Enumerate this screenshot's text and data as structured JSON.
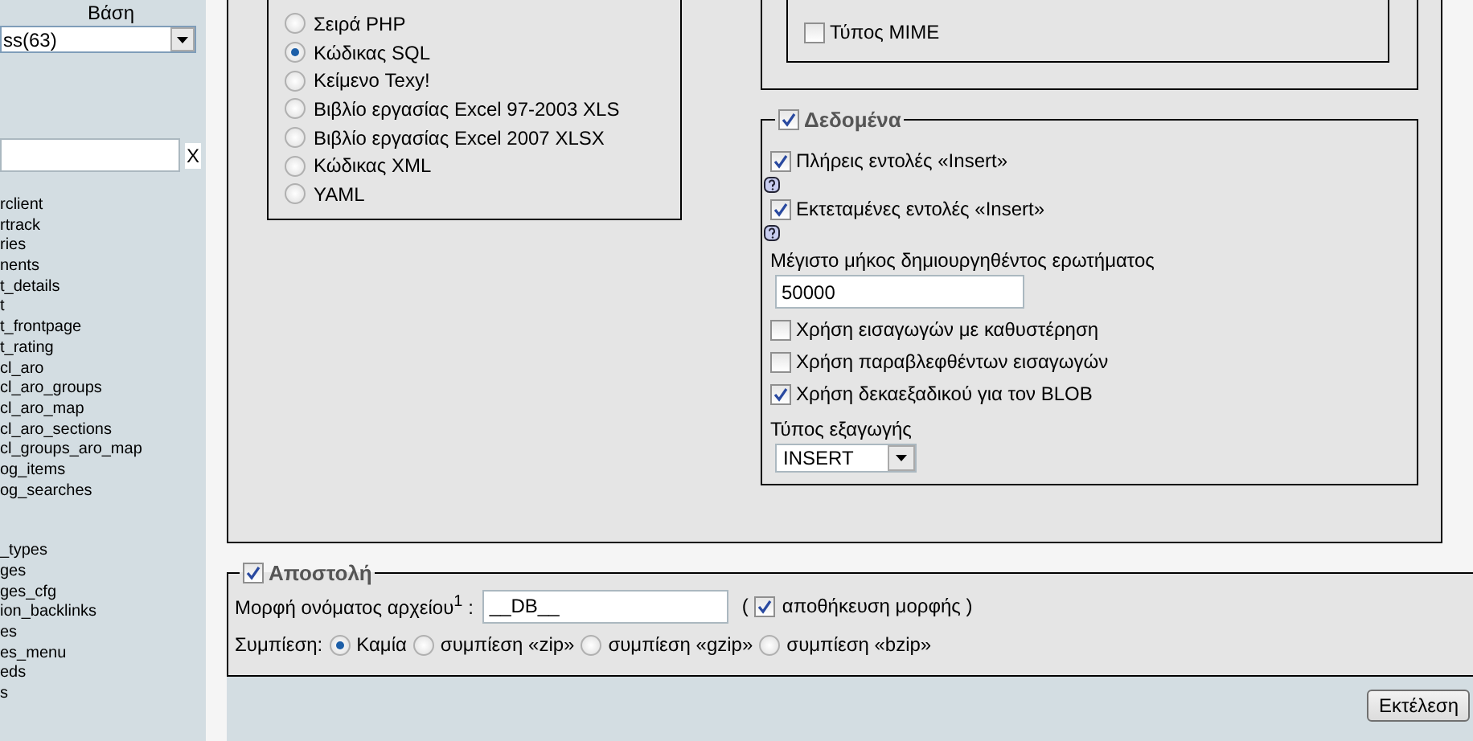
{
  "sidebar": {
    "database_label": "Βάση",
    "database_select": "ss(63)",
    "filter_clear": "X",
    "table_groups": [
      {
        "items": [
          "rclient",
          "rtrack",
          "ries",
          "nents",
          "t_details",
          "t",
          "t_frontpage",
          "t_rating",
          "cl_aro",
          "cl_aro_groups",
          "cl_aro_map",
          "cl_aro_sections",
          "cl_groups_aro_map",
          "og_items",
          "og_searches"
        ]
      },
      {
        "items": [
          "_types",
          "ges",
          "ges_cfg",
          "ion_backlinks",
          "es",
          "es_menu",
          "eds",
          "s"
        ]
      }
    ]
  },
  "export_formats": [
    {
      "label": "Σειρά PHP",
      "selected": false
    },
    {
      "label": "Κώδικας SQL",
      "selected": true
    },
    {
      "label": "Κείμενο Texy!",
      "selected": false
    },
    {
      "label": "Βιβλίο εργασίας Excel 97-2003 XLS",
      "selected": false
    },
    {
      "label": "Βιβλίο εργασίας Excel 2007 XLSX",
      "selected": false
    },
    {
      "label": "Κώδικας XML",
      "selected": false
    },
    {
      "label": "YAML",
      "selected": false
    }
  ],
  "structure_options": [
    {
      "label": "Τύπος MIME",
      "checked": false
    }
  ],
  "data_section": {
    "legend": "Δεδομένα",
    "checked": true,
    "items": [
      {
        "kind": "checkbox",
        "label": "Πλήρεις εντολές «Insert»",
        "checked": true
      },
      {
        "kind": "help"
      },
      {
        "kind": "checkbox",
        "label": "Εκτεταμένες εντολές «Insert»",
        "checked": true
      },
      {
        "kind": "help"
      },
      {
        "kind": "field",
        "label": "Μέγιστο μήκος δημιουργηθέντος ερωτήματος",
        "value": "50000"
      },
      {
        "kind": "checkbox",
        "label": "Χρήση εισαγωγών με καθυστέρηση",
        "checked": false
      },
      {
        "kind": "checkbox",
        "label": "Χρήση παραβλεφθέντων εισαγωγών",
        "checked": false
      },
      {
        "kind": "checkbox",
        "label": "Χρήση δεκαεξαδικού για τον BLOB",
        "checked": true
      },
      {
        "kind": "select",
        "label": "Τύπος εξαγωγής",
        "value": "INSERT"
      }
    ]
  },
  "sending": {
    "legend": "Αποστολή",
    "checked": true,
    "filename_label": "Μορφή ονόματος αρχείου$^{1}$ :",
    "filename_value": "__DB__",
    "remember_open": "(",
    "remember_checked": true,
    "remember_label": "αποθήκευση μορφής )",
    "compression_label": "Συμπίεση:",
    "compression": [
      {
        "label": "Καμία",
        "selected": true
      },
      {
        "label": "συμπίεση «zip»",
        "selected": false
      },
      {
        "label": "συμπίεση «gzip»",
        "selected": false
      },
      {
        "label": "συμπίεση «bzip»",
        "selected": false
      }
    ]
  },
  "submit": "Εκτέλεση"
}
